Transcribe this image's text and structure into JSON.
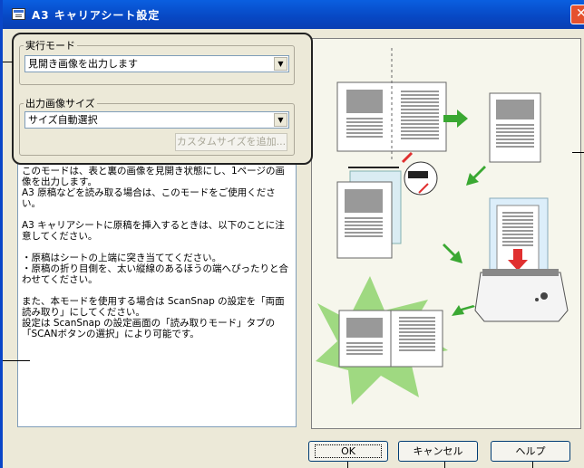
{
  "window": {
    "title": "A3 キャリアシート設定"
  },
  "mode": {
    "legend": "実行モード",
    "selected": "見開き画像を出力します"
  },
  "size": {
    "legend": "出力画像サイズ",
    "selected": "サイズ自動選択",
    "custom_button": "カスタムサイズを追加..."
  },
  "description": {
    "paragraphs": [
      "このモードは、表と裏の画像を見開き状態にし、1ページの画像を出力します。\nA3 原稿などを読み取る場合は、このモードをご使用ください。",
      "A3 キャリアシートに原稿を挿入するときは、以下のことに注意してください。",
      "・原稿はシートの上端に突き当ててください。\n・原稿の折り目側を、太い縦線のあるほうの端へぴったりと合わせてください。",
      "また、本モードを使用する場合は ScanSnap の設定を「両面読み取り」にしてください。\n設定は ScanSnap の設定画面の「読み取りモード」タブの「SCANボタンの選択」により可能です。"
    ]
  },
  "buttons": {
    "ok": "OK",
    "cancel": "キャンセル",
    "help": "ヘルプ"
  },
  "colors": {
    "titlebar": "#0a50d8",
    "arrow_green": "#3aa832",
    "burst_green": "#8fd36e",
    "red_arrow": "#e03030"
  }
}
